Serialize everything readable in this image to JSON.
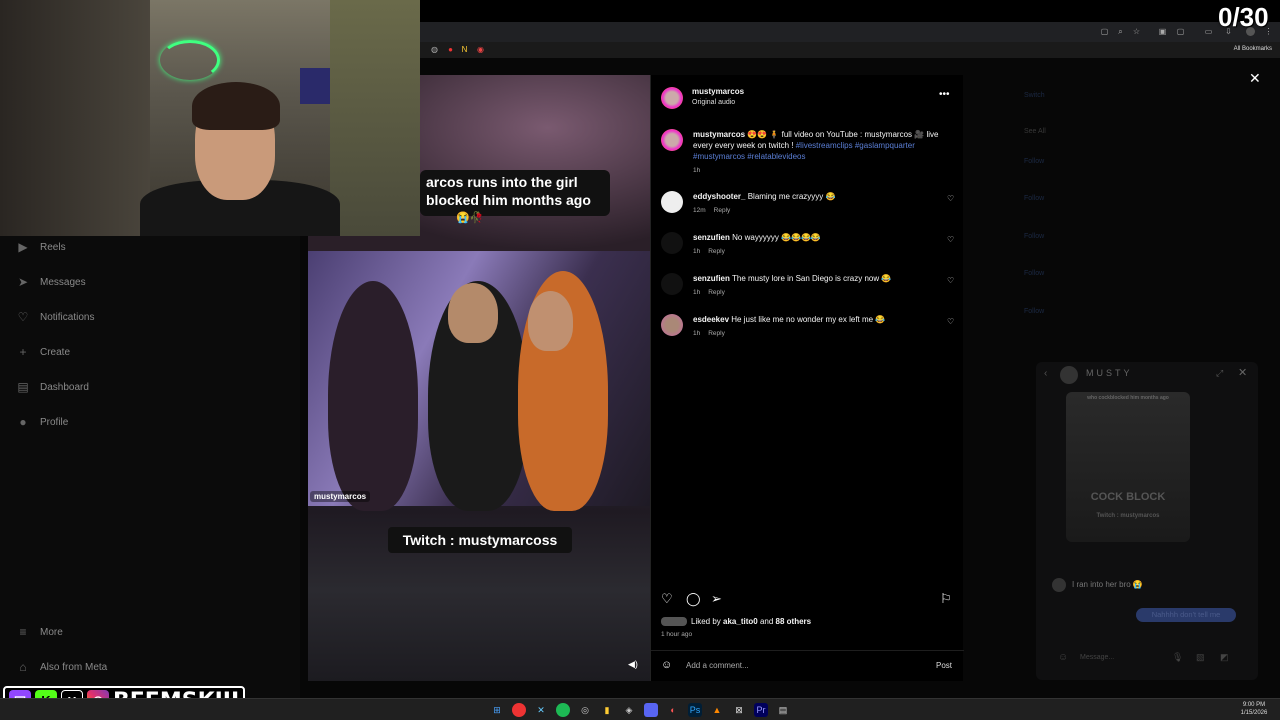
{
  "counter": "0/30",
  "browser": {
    "bookmarks_label": "All Bookmarks"
  },
  "sidebar": {
    "items": [
      {
        "label": "Reels",
        "icon": "reels-icon"
      },
      {
        "label": "Messages",
        "icon": "send-icon"
      },
      {
        "label": "Notifications",
        "icon": "heart-icon"
      },
      {
        "label": "Create",
        "icon": "plus-icon"
      },
      {
        "label": "Dashboard",
        "icon": "chart-icon"
      },
      {
        "label": "Profile",
        "icon": "avatar-icon"
      },
      {
        "label": "More",
        "icon": "menu-icon"
      },
      {
        "label": "Also from Meta",
        "icon": "meta-icon"
      }
    ]
  },
  "right_bg": {
    "switch": "Switch",
    "see_all": "See All",
    "follow": "Follow"
  },
  "video": {
    "caption_line1": "arcos runs into the girl",
    "caption_line2": "blocked him months ago",
    "caption_emoji": "😭🥀",
    "watermark": "mustymarcos",
    "twitch_text": "Twitch : mustymarcoss"
  },
  "post": {
    "username": "mustymarcos",
    "audio": "Original audio",
    "caption_user": "mustymarcos",
    "caption_text": "😍😍 🧍 full video on YouTube : mustymarcos 🎥 live every every week on twitch ! ",
    "caption_tags": "#livestreamclips #gaslampquarter #mustymarcos #relatablevideos",
    "caption_time": "1h",
    "comments": [
      {
        "user": "eddyshooter_",
        "text": "Blaming me crazyyyy 😂",
        "time": "12m",
        "reply": "Reply"
      },
      {
        "user": "senzufien",
        "text": "No wayyyyyy 😂😂😂😂",
        "time": "1h",
        "reply": "Reply"
      },
      {
        "user": "senzufien",
        "text": "The musty lore in San Diego is crazy now 😂",
        "time": "1h",
        "reply": "Reply"
      },
      {
        "user": "esdeekev",
        "text": "He just like me no wonder my ex left me 😂",
        "time": "1h",
        "reply": "Reply"
      }
    ],
    "liked_prefix": "Liked by ",
    "liked_user": "aka_tito0",
    "liked_mid": " and ",
    "liked_others": "88 others",
    "post_time": "1 hour ago",
    "add_comment_placeholder": "Add a comment...",
    "post_button": "Post"
  },
  "dm": {
    "title": "MUSTY",
    "thumb_top": "who cockblocked him months ago",
    "thumb_text": "COCK BLOCK",
    "thumb_sub": "Twitch : mustymarcos",
    "msg_in": "I ran into her bro 😭",
    "msg_out": "Nahhhh don't tell me",
    "input_placeholder": "Message..."
  },
  "social": {
    "name": "BEEMSKIII"
  },
  "taskbar": {
    "time": "9:00 PM",
    "date": "1/15/2026"
  },
  "colors": {
    "link": "#5b7fd6",
    "panel_bg": "#000000",
    "neon": "#3fff80"
  }
}
